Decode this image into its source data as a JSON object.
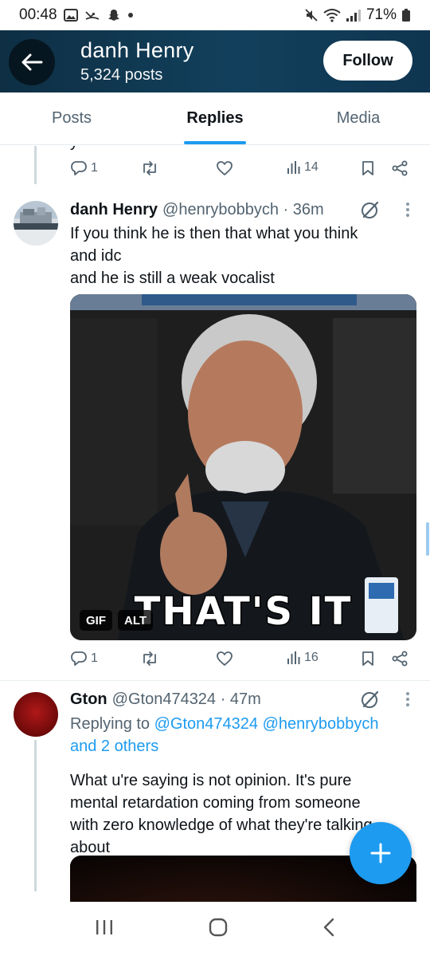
{
  "status_bar": {
    "time": "00:48",
    "battery": "71%"
  },
  "header": {
    "name": "danh Henry",
    "posts": "5,324 posts",
    "follow_label": "Follow"
  },
  "tabs": [
    {
      "label": "Posts",
      "active": false
    },
    {
      "label": "Replies",
      "active": true
    },
    {
      "label": "Media",
      "active": false
    }
  ],
  "prev_tweet": {
    "fragment": "y",
    "replies": "1",
    "views": "14"
  },
  "tweet1": {
    "name": "danh Henry",
    "handle_time": "@henrybobbych · 36m",
    "text_line1": "If you think he is then that what you think",
    "text_line2": "and idc",
    "text_line3": "and he is still a weak vocalist",
    "media_caption": "THAT'S IT",
    "gif_badge": "GIF",
    "alt_badge": "ALT",
    "replies": "1",
    "views": "16"
  },
  "tweet2": {
    "name": "Gton",
    "handle_time": "@Gton474324 · 47m",
    "replying_prefix": "Replying to ",
    "replying_to": "@Gton474324 @henrybobbych",
    "replying_to_line2": "and 2 others",
    "text_line1": "What u're saying is not opinion. It's pure",
    "text_line2": "mental retardation coming from someone",
    "text_line3": "with zero knowledge of what they're talking",
    "text_line4": "about"
  },
  "colors": {
    "accent": "#1d9bf0",
    "header_bg": "#12405c",
    "muted": "#536471"
  }
}
